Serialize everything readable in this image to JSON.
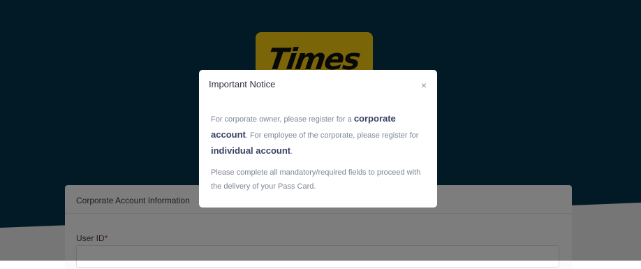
{
  "logo": {
    "text": "Times"
  },
  "form": {
    "section_title": "Corporate Account Information",
    "user_id_label": "User ID",
    "required_mark": "*"
  },
  "modal": {
    "title": "Important Notice",
    "close_glyph": "×",
    "p1_a": "For corporate owner, please register for a ",
    "p1_b": "corporate account",
    "p1_c": ". For employee of the corporate, please register for ",
    "p1_d": "individual account",
    "p1_e": ".",
    "p2": "Please complete all mandatory/required fields to proceed with the delivery of your Pass Card."
  },
  "colors": {
    "header_bg": "#02344b",
    "logo_yellow": "#f5cc12",
    "emphasis_text": "#3b4164"
  }
}
